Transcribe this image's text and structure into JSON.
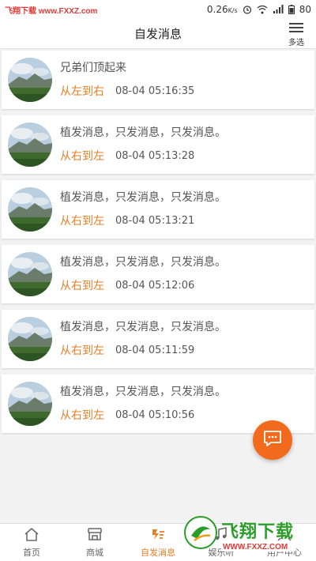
{
  "status_bar": {
    "watermark": "飞翔下载 www.FXXZ.com",
    "speed": "0.26",
    "speed_unit": "K/s",
    "battery": "80"
  },
  "header": {
    "title": "自发消息",
    "multi_select_label": "多选"
  },
  "messages": [
    {
      "text": "兄弟们顶起来",
      "direction": "从左到右",
      "time": "08-04 05:16:35"
    },
    {
      "text": "植发消息，只发消息，只发消息。",
      "direction": "从右到左",
      "time": "08-04 05:13:28"
    },
    {
      "text": "植发消息，只发消息，只发消息。",
      "direction": "从右到左",
      "time": "08-04 05:13:21"
    },
    {
      "text": "植发消息，只发消息，只发消息。",
      "direction": "从右到左",
      "time": "08-04 05:12:06"
    },
    {
      "text": "植发消息，只发消息，只发消息。",
      "direction": "从右到左",
      "time": "08-04 05:11:59"
    },
    {
      "text": "植发消息，只发消息，只发消息。",
      "direction": "从右到左",
      "time": "08-04 05:10:56"
    }
  ],
  "tabs": [
    {
      "label": "首页",
      "icon": "home-icon"
    },
    {
      "label": "商城",
      "icon": "store-icon"
    },
    {
      "label": "自发消息",
      "icon": "message-icon",
      "active": true
    },
    {
      "label": "娱乐听",
      "icon": "music-icon"
    },
    {
      "label": "用户中心",
      "icon": "user-icon"
    }
  ],
  "bottom_watermark": {
    "title": "飞翔下载",
    "url": "WWW.FXXZ.COM"
  },
  "colors": {
    "accent": "#e67e22",
    "fab": "#f26b1d"
  }
}
